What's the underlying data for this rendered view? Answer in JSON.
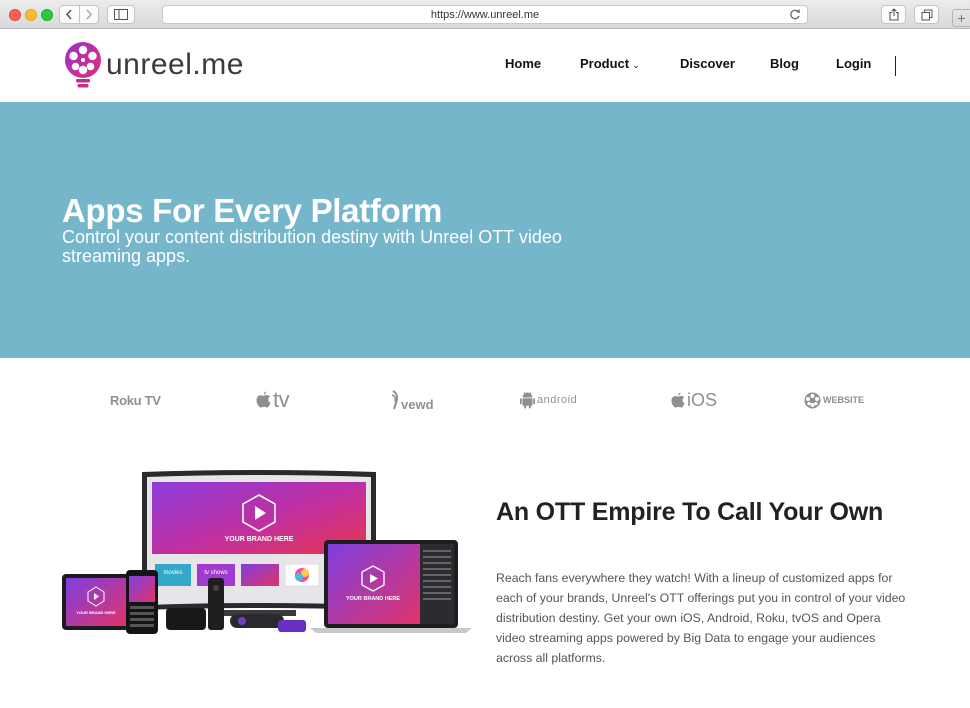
{
  "browser": {
    "url": "https://www.unreel.me",
    "new_tab_label": "+"
  },
  "header": {
    "logo_text": "unreel.me",
    "nav": {
      "home": "Home",
      "product": "Product",
      "discover": "Discover",
      "blog": "Blog",
      "login": "Login"
    }
  },
  "hero": {
    "title": "Apps For Every Platform",
    "subtitle": "Control your content distribution destiny with Unreel OTT video streaming apps."
  },
  "platforms": {
    "roku": "Roku TV",
    "appletv": "tv",
    "vewd": "vewd",
    "android": "android",
    "ios": "iOS",
    "website": "WEBSITE"
  },
  "devices_image": {
    "brand_label": "YOUR BRAND HERE",
    "tile_movies": "movies",
    "tile_tvshows": "tv shows"
  },
  "feature": {
    "title": "An OTT Empire To Call Your Own",
    "body": "Reach fans everywhere they watch! With a lineup of customized apps for each of your brands, Unreel's OTT offerings put you in control of your video distribution destiny. Get your own iOS, Android, Roku, tvOS and Opera video streaming apps powered by Big Data to engage your audiences across all platforms."
  },
  "colors": {
    "hero_bg": "#75b6cb",
    "brand_purple": "#9b2fc9",
    "brand_pink": "#e0307a"
  }
}
